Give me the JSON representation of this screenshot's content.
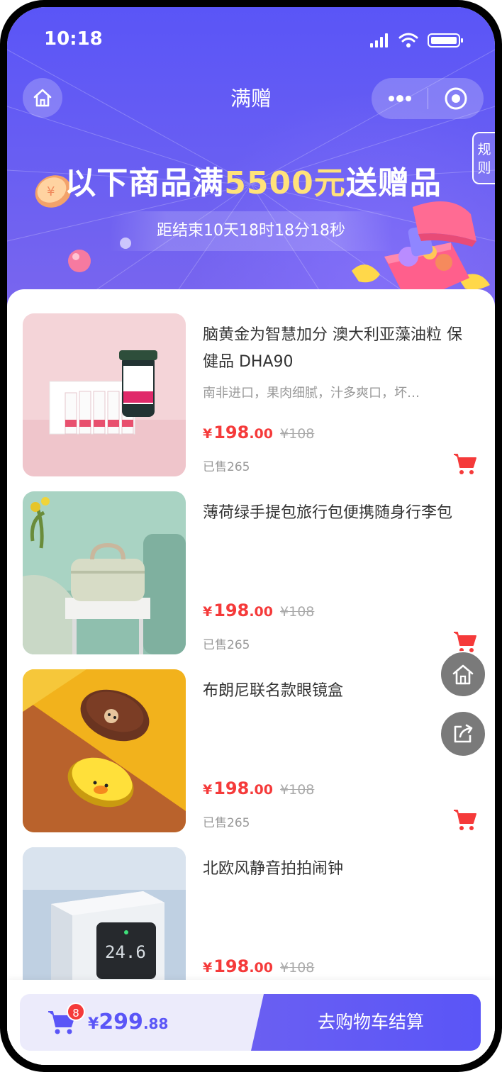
{
  "status_bar": {
    "time": "10:18"
  },
  "nav": {
    "title": "满赠"
  },
  "rules_tab": {
    "line1": "规",
    "line2": "则"
  },
  "promo": {
    "headline_before": "以下商品满",
    "headline_amount": "5500元",
    "headline_after": "送赠品",
    "countdown": "距结束10天18时18分18秒"
  },
  "products": [
    {
      "name": "脑黄金为智慧加分 澳大利亚藻油粒 保健品 DHA90",
      "desc": "南非进口，果肉细腻，汁多爽口，坏…",
      "currency": "¥",
      "price_int": "198",
      "price_dec": ".00",
      "orig_price": "¥108",
      "sold": "已售265"
    },
    {
      "name": "薄荷绿手提包旅行包便携随身行李包",
      "desc": "",
      "currency": "¥",
      "price_int": "198",
      "price_dec": ".00",
      "orig_price": "¥108",
      "sold": "已售265"
    },
    {
      "name": "布朗尼联名款眼镜盒",
      "desc": "",
      "currency": "¥",
      "price_int": "198",
      "price_dec": ".00",
      "orig_price": "¥108",
      "sold": "已售265"
    },
    {
      "name": "北欧风静音拍拍闹钟",
      "desc": "",
      "currency": "¥",
      "price_int": "198",
      "price_dec": ".00",
      "orig_price": "¥108",
      "sold": ""
    }
  ],
  "clock_display": "24.6",
  "cart": {
    "badge": "8",
    "currency": "¥",
    "total_int": "299",
    "total_dec": ".88",
    "checkout_label": "去购物车结算"
  },
  "colors": {
    "accent": "#5a55f7",
    "price": "#f53a3a",
    "highlight": "#ffe27a"
  },
  "icons": [
    "home-icon",
    "more-icon",
    "target-icon",
    "cart-icon",
    "share-icon",
    "signal-icon",
    "wifi-icon",
    "battery-icon"
  ]
}
